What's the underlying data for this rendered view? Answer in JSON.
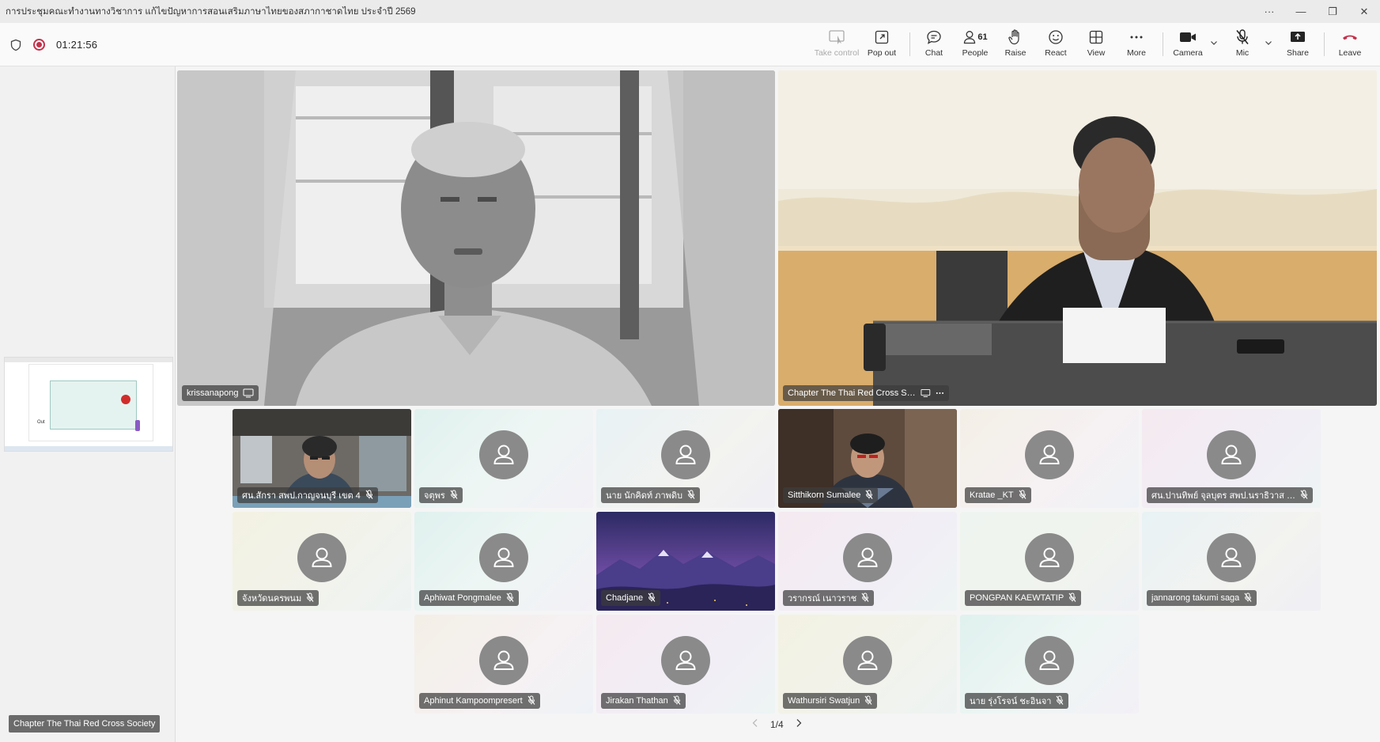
{
  "window": {
    "title": "การประชุมคณะทำงานทางวิชาการ แก้ไขปัญหาการสอนเสริมภาษาไทยของสภากาชาดไทย ประจำปี 2569",
    "more_glyph": "···",
    "minimize_glyph": "—",
    "restore_glyph": "❐",
    "close_glyph": "✕"
  },
  "toolbar": {
    "timer": "01:21:56",
    "take_control": "Take control",
    "pop_out": "Pop out",
    "chat": "Chat",
    "people": "People",
    "people_count": "61",
    "raise": "Raise",
    "react": "React",
    "view": "View",
    "more": "More",
    "camera": "Camera",
    "mic": "Mic",
    "share": "Share",
    "leave": "Leave"
  },
  "colors": {
    "leave_red": "#c4314b",
    "record_red": "#c4314b"
  },
  "sidebar": {
    "share_thumb_label": "Out",
    "presenter": "Chapter The Thai Red Cross Society"
  },
  "stage": {
    "featured": [
      {
        "name": "krissanapong"
      },
      {
        "name": "Chapter The Thai Red Cross Society"
      }
    ],
    "tiles": [
      {
        "name": "ศน.สักรา สพป.กาญจนบุรี เขต 4"
      },
      {
        "name": "จตุพร"
      },
      {
        "name": "นาย นักคิดท์ ภาพดิบ"
      },
      {
        "name": "Sitthikorn Sumalee"
      },
      {
        "name": "Kratae _KT"
      },
      {
        "name": "ศน.ปานทิพย์ จุลบุตร สพป.นราธิวาส เ..."
      },
      {
        "name": "จังหวัดนครพนม"
      },
      {
        "name": "Aphiwat Pongmalee"
      },
      {
        "name": "Chadjane"
      },
      {
        "name": "วรากรณ์ เนาวราช"
      },
      {
        "name": "PONGPAN KAEWTATIP"
      },
      {
        "name": "jannarong takumi saga"
      },
      {
        "name": "Aphinut Kampoompresert"
      },
      {
        "name": "Jirakan Thathan"
      },
      {
        "name": "Wathursiri Swatjun"
      },
      {
        "name": "นาย รุ่งโรจน์ ชะอินจา"
      }
    ]
  },
  "pager": {
    "label": "1/4"
  }
}
